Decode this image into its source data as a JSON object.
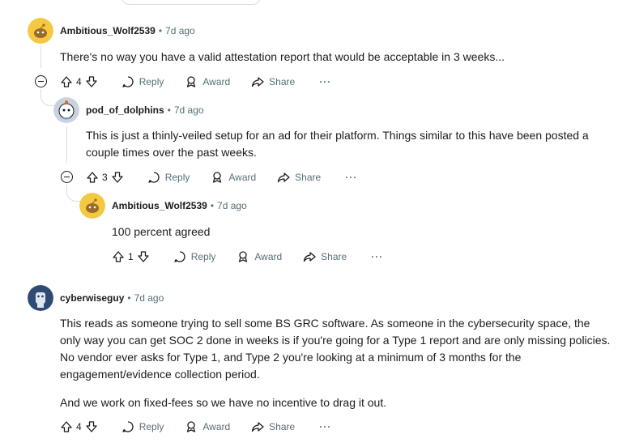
{
  "comments": [
    {
      "username": "Ambitious_Wolf2539",
      "age": "7d ago",
      "paragraphs": [
        "There's no way you have a valid attestation report that would be acceptable in 3 weeks..."
      ],
      "votes": "4",
      "avatar_color": "#f5c842"
    },
    {
      "username": "pod_of_dolphins",
      "age": "7d ago",
      "paragraphs": [
        "This is just a thinly-veiled setup for an ad for their platform. Things similar to this have been posted a couple times over the past weeks."
      ],
      "votes": "3",
      "avatar_color": "#c9d3e0"
    },
    {
      "username": "Ambitious_Wolf2539",
      "age": "7d ago",
      "paragraphs": [
        "100 percent agreed"
      ],
      "votes": "1",
      "avatar_color": "#f5c842"
    },
    {
      "username": "cyberwiseguy",
      "age": "7d ago",
      "paragraphs": [
        "This reads as someone trying to sell some BS GRC software. As someone in the cybersecurity space, the only way you can get SOC 2 done in weeks is if you're going for a Type 1 report and are only missing policies. No vendor ever asks for Type 1, and Type 2 you're looking at a minimum of 3 months for the engagement/evidence collection period.",
        "And we work on fixed-fees so we have no incentive to drag it out."
      ],
      "votes": "4",
      "avatar_color": "#2f4a73"
    }
  ],
  "labels": {
    "reply": "Reply",
    "award": "Award",
    "share": "Share",
    "more": "···",
    "separator": "•"
  }
}
